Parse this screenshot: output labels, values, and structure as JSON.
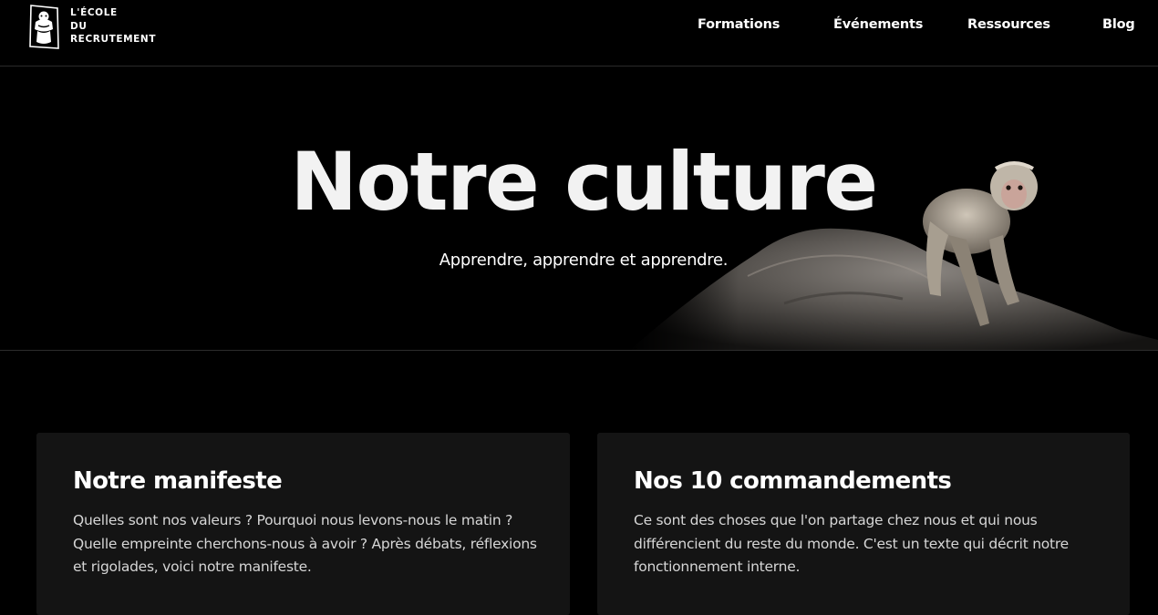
{
  "logo": {
    "icon": "monkey-logo-icon",
    "lines": [
      "L'ÉCOLE",
      "DU",
      "RECRUTEMENT"
    ]
  },
  "nav": {
    "items": [
      {
        "label": "Formations"
      },
      {
        "label": "Événements"
      },
      {
        "label": "Ressources"
      },
      {
        "label": "Blog"
      }
    ]
  },
  "hero": {
    "title": "Notre culture",
    "subtitle": "Apprendre, apprendre et apprendre.",
    "image": "monkey-on-rock-photo"
  },
  "cards": [
    {
      "title": "Notre manifeste",
      "text": "Quelles sont nos valeurs ? Pourquoi nous levons-nous le matin ? Quelle empreinte cherchons-nous à avoir ? Après débats, réflexions et rigolades, voici notre manifeste."
    },
    {
      "title": "Nos 10 commandements",
      "text": "Ce sont des choses que l'on partage chez nous et qui nous différencient du reste du monde. C'est un texte qui décrit notre fonctionnement interne."
    }
  ],
  "colors": {
    "background": "#000000",
    "card_background": "#141414",
    "text": "#ffffff",
    "body_text": "#d6d6d6"
  }
}
